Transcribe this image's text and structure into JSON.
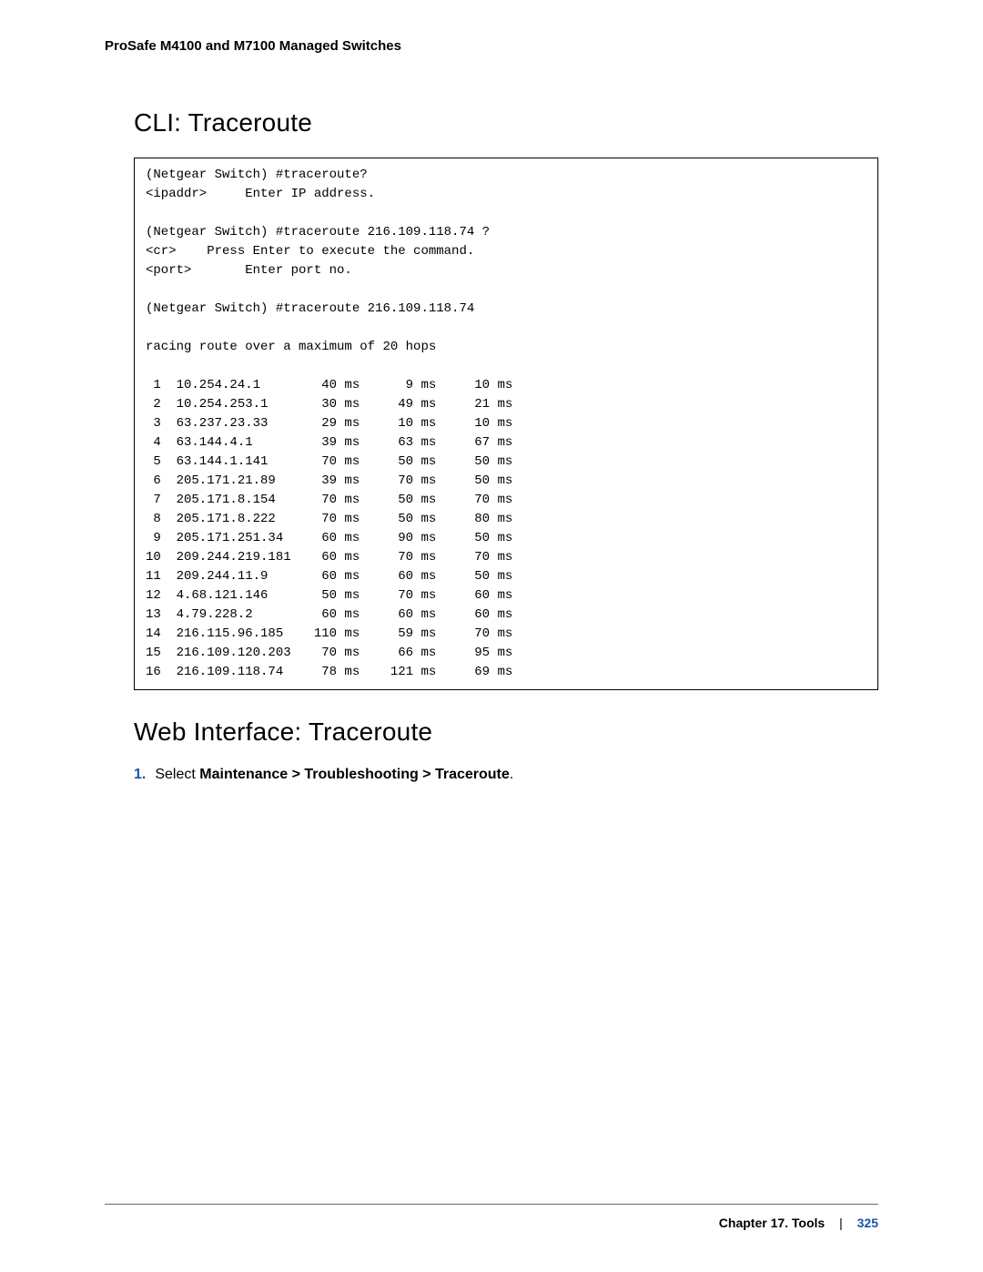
{
  "running_header": "ProSafe M4100 and M7100 Managed Switches",
  "heading1": "CLI: Traceroute",
  "cli_output": "(Netgear Switch) #traceroute?\n<ipaddr>     Enter IP address.\n\n(Netgear Switch) #traceroute 216.109.118.74 ?\n<cr>    Press Enter to execute the command.\n<port>       Enter port no.\n\n(Netgear Switch) #traceroute 216.109.118.74\n\nracing route over a maximum of 20 hops\n\n 1  10.254.24.1        40 ms      9 ms     10 ms\n 2  10.254.253.1       30 ms     49 ms     21 ms\n 3  63.237.23.33       29 ms     10 ms     10 ms\n 4  63.144.4.1         39 ms     63 ms     67 ms\n 5  63.144.1.141       70 ms     50 ms     50 ms\n 6  205.171.21.89      39 ms     70 ms     50 ms\n 7  205.171.8.154      70 ms     50 ms     70 ms\n 8  205.171.8.222      70 ms     50 ms     80 ms\n 9  205.171.251.34     60 ms     90 ms     50 ms\n10  209.244.219.181    60 ms     70 ms     70 ms\n11  209.244.11.9       60 ms     60 ms     50 ms\n12  4.68.121.146       50 ms     70 ms     60 ms\n13  4.79.228.2         60 ms     60 ms     60 ms\n14  216.115.96.185    110 ms     59 ms     70 ms\n15  216.109.120.203    70 ms     66 ms     95 ms\n16  216.109.118.74     78 ms    121 ms     69 ms",
  "heading2": "Web Interface: Traceroute",
  "step": {
    "number": "1.",
    "prefix": "Select ",
    "bold": "Maintenance > Troubleshooting > Traceroute",
    "suffix": "."
  },
  "footer": {
    "chapter": "Chapter 17.  Tools",
    "sep": "|",
    "page": "325"
  }
}
